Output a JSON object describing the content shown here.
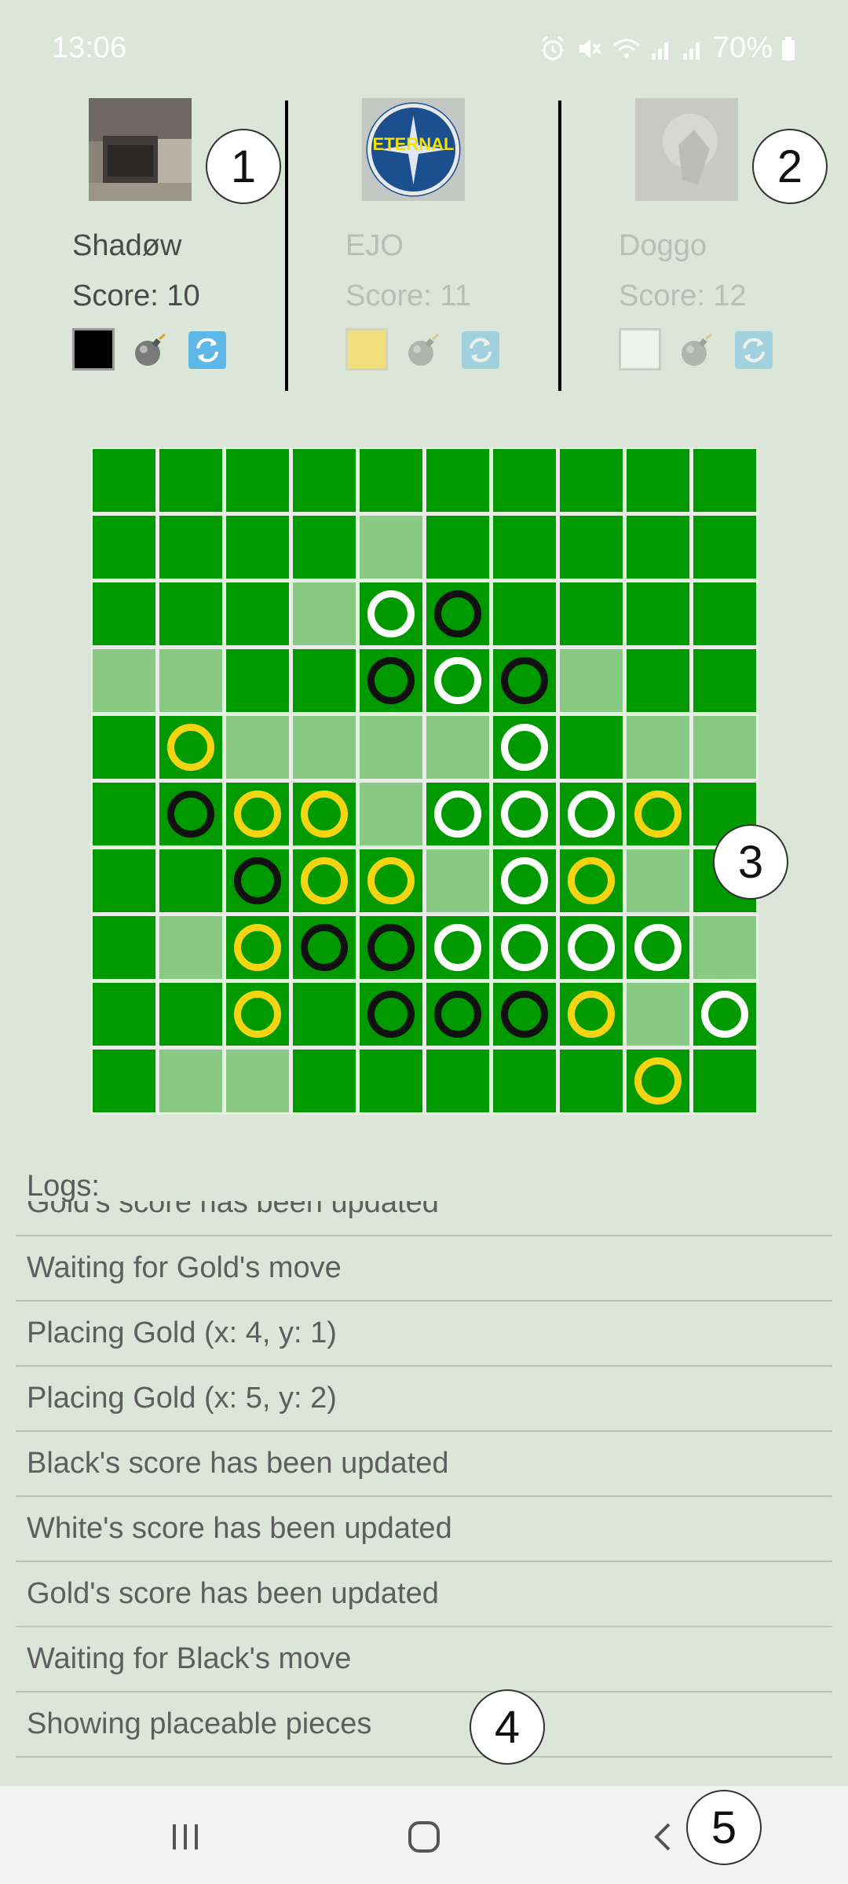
{
  "status_bar": {
    "time": "13:06",
    "battery": "70%",
    "icons": [
      "alarm-icon",
      "mute-icon",
      "wifi-icon",
      "signal-icon",
      "signal-icon",
      "battery-icon"
    ]
  },
  "players": [
    {
      "name": "Shadøw",
      "score": "Score: 10",
      "color": "#000000",
      "active": true,
      "avatar": "kitchen-photo"
    },
    {
      "name": "EJO",
      "score": "Score: 11",
      "color": "#f0df7a",
      "active": false,
      "avatar": "eternal-emblem",
      "avatar_text": "ETERNAL"
    },
    {
      "name": "Doggo",
      "score": "Score: 12",
      "color": "#edf2ea",
      "active": false,
      "avatar": "blurred-photo"
    }
  ],
  "badges": [
    "1",
    "2",
    "3",
    "4",
    "5"
  ],
  "board": {
    "size": 10,
    "colors": {
      "dark": "#009900",
      "light": "#88c983",
      "black": "#111111",
      "white": "#ffffff",
      "gold": "#f5d414"
    },
    "light_cells": [
      [
        1,
        4
      ],
      [
        2,
        3
      ],
      [
        3,
        0
      ],
      [
        3,
        1
      ],
      [
        3,
        7
      ],
      [
        4,
        2
      ],
      [
        4,
        3
      ],
      [
        4,
        4
      ],
      [
        4,
        5
      ],
      [
        4,
        8
      ],
      [
        4,
        9
      ],
      [
        5,
        4
      ],
      [
        6,
        5
      ],
      [
        6,
        8
      ],
      [
        7,
        1
      ],
      [
        7,
        9
      ],
      [
        8,
        8
      ],
      [
        9,
        1
      ],
      [
        9,
        2
      ]
    ],
    "pieces": [
      {
        "r": 2,
        "c": 4,
        "color": "white"
      },
      {
        "r": 2,
        "c": 5,
        "color": "black"
      },
      {
        "r": 3,
        "c": 4,
        "color": "black"
      },
      {
        "r": 3,
        "c": 5,
        "color": "white"
      },
      {
        "r": 3,
        "c": 6,
        "color": "black"
      },
      {
        "r": 4,
        "c": 1,
        "color": "gold"
      },
      {
        "r": 4,
        "c": 6,
        "color": "white"
      },
      {
        "r": 5,
        "c": 1,
        "color": "black"
      },
      {
        "r": 5,
        "c": 2,
        "color": "gold"
      },
      {
        "r": 5,
        "c": 3,
        "color": "gold"
      },
      {
        "r": 5,
        "c": 5,
        "color": "white"
      },
      {
        "r": 5,
        "c": 6,
        "color": "white"
      },
      {
        "r": 5,
        "c": 7,
        "color": "white"
      },
      {
        "r": 5,
        "c": 8,
        "color": "gold"
      },
      {
        "r": 6,
        "c": 2,
        "color": "black"
      },
      {
        "r": 6,
        "c": 3,
        "color": "gold"
      },
      {
        "r": 6,
        "c": 4,
        "color": "gold"
      },
      {
        "r": 6,
        "c": 6,
        "color": "white"
      },
      {
        "r": 6,
        "c": 7,
        "color": "gold"
      },
      {
        "r": 7,
        "c": 2,
        "color": "gold"
      },
      {
        "r": 7,
        "c": 3,
        "color": "black"
      },
      {
        "r": 7,
        "c": 4,
        "color": "black"
      },
      {
        "r": 7,
        "c": 5,
        "color": "white"
      },
      {
        "r": 7,
        "c": 6,
        "color": "white"
      },
      {
        "r": 7,
        "c": 7,
        "color": "white"
      },
      {
        "r": 7,
        "c": 8,
        "color": "white"
      },
      {
        "r": 8,
        "c": 2,
        "color": "gold"
      },
      {
        "r": 8,
        "c": 4,
        "color": "black"
      },
      {
        "r": 8,
        "c": 5,
        "color": "black"
      },
      {
        "r": 8,
        "c": 6,
        "color": "black"
      },
      {
        "r": 8,
        "c": 7,
        "color": "gold"
      },
      {
        "r": 8,
        "c": 9,
        "color": "white"
      },
      {
        "r": 9,
        "c": 8,
        "color": "gold"
      }
    ]
  },
  "logs": {
    "label": "Logs:",
    "items": [
      "Gold's score has been updated",
      "Waiting for Gold's move",
      "Placing Gold (x: 4, y: 1)",
      "Placing Gold (x: 5, y: 2)",
      "Black's score has been updated",
      "White's score has been updated",
      "Gold's score has been updated",
      "Waiting for Black's move",
      "Showing placeable pieces"
    ]
  },
  "nav": {
    "recent": "|||",
    "home": "○",
    "back": "‹"
  }
}
